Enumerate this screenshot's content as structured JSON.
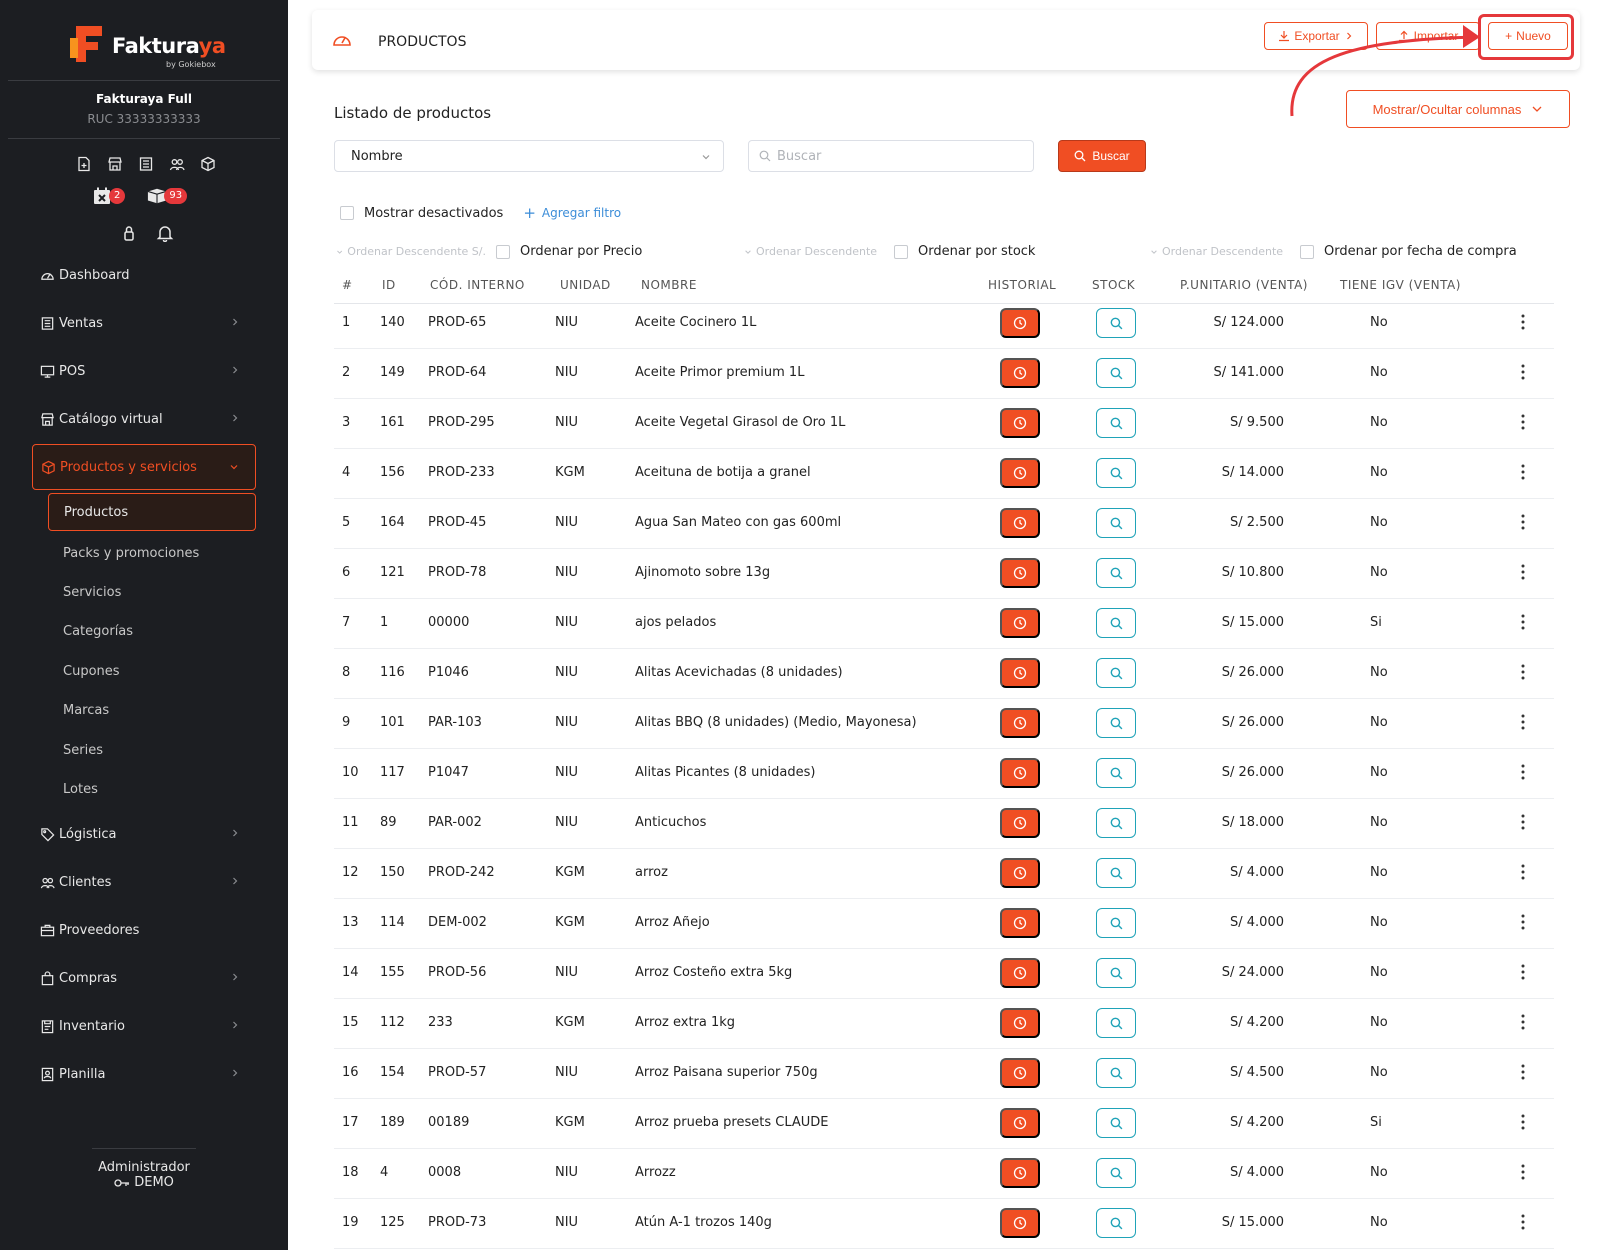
{
  "brand": {
    "name_a": "Faktura",
    "name_b": "ya",
    "sub": "by Gokiebox"
  },
  "company": {
    "name": "Fakturaya Full",
    "ruc": "RUC 33333333333"
  },
  "badges": {
    "calendar_count": "2",
    "box_count": "93"
  },
  "menu": {
    "dashboard": "Dashboard",
    "ventas": "Ventas",
    "pos": "POS",
    "catalogo": "Catálogo virtual",
    "productos_servicios": "Productos y servicios",
    "logistica": "Lógistica",
    "clientes": "Clientes",
    "proveedores": "Proveedores",
    "compras": "Compras",
    "inventario": "Inventario",
    "planilla": "Planilla"
  },
  "submenu": {
    "productos": "Productos",
    "packs": "Packs y promociones",
    "servicios": "Servicios",
    "categorias": "Categorías",
    "cupones": "Cupones",
    "marcas": "Marcas",
    "series": "Series",
    "lotes": "Lotes"
  },
  "footer": {
    "admin": "Administrador",
    "demo": "DEMO"
  },
  "header": {
    "title": "PRODUCTOS",
    "export": "Exportar",
    "import": "Importar",
    "new": "Nuevo"
  },
  "list": {
    "title": "Listado de productos",
    "columns_btn": "Mostrar/Ocultar columnas",
    "select_value": "Nombre",
    "search_placeholder": "Buscar",
    "search_btn": "Buscar",
    "show_disabled": "Mostrar desactivados",
    "add_filter": "Agregar filtro",
    "sort_placeholder_1": "Ordenar Descendente S/.",
    "sort_label_1": "Ordenar por Precio",
    "sort_placeholder_2": "Ordenar Descendente",
    "sort_label_2": "Ordenar por stock",
    "sort_placeholder_3": "Ordenar Descendente",
    "sort_label_3": "Ordenar por fecha de compra"
  },
  "table": {
    "headers": [
      "#",
      "ID",
      "CÓD. INTERNO",
      "UNIDAD",
      "NOMBRE",
      "HISTORIAL",
      "STOCK",
      "P.UNITARIO (VENTA)",
      "TIENE IGV (VENTA)"
    ],
    "rows": [
      [
        "1",
        "140",
        "PROD-65",
        "NIU",
        "Aceite Cocinero 1L",
        "S/ 124.000",
        "No"
      ],
      [
        "2",
        "149",
        "PROD-64",
        "NIU",
        "Aceite Primor premium 1L",
        "S/ 141.000",
        "No"
      ],
      [
        "3",
        "161",
        "PROD-295",
        "NIU",
        "Aceite Vegetal Girasol de Oro 1L",
        "S/ 9.500",
        "No"
      ],
      [
        "4",
        "156",
        "PROD-233",
        "KGM",
        "Aceituna de botija a granel",
        "S/ 14.000",
        "No"
      ],
      [
        "5",
        "164",
        "PROD-45",
        "NIU",
        "Agua San Mateo con gas 600ml",
        "S/ 2.500",
        "No"
      ],
      [
        "6",
        "121",
        "PROD-78",
        "NIU",
        "Ajinomoto sobre 13g",
        "S/ 10.800",
        "No"
      ],
      [
        "7",
        "1",
        "00000",
        "NIU",
        "ajos pelados",
        "S/ 15.000",
        "Si"
      ],
      [
        "8",
        "116",
        "P1046",
        "NIU",
        "Alitas Acevichadas (8 unidades)",
        "S/ 26.000",
        "No"
      ],
      [
        "9",
        "101",
        "PAR-103",
        "NIU",
        "Alitas BBQ (8 unidades) (Medio, Mayonesa)",
        "S/ 26.000",
        "No"
      ],
      [
        "10",
        "117",
        "P1047",
        "NIU",
        "Alitas Picantes (8 unidades)",
        "S/ 26.000",
        "No"
      ],
      [
        "11",
        "89",
        "PAR-002",
        "NIU",
        "Anticuchos",
        "S/ 18.000",
        "No"
      ],
      [
        "12",
        "150",
        "PROD-242",
        "KGM",
        "arroz",
        "S/ 4.000",
        "No"
      ],
      [
        "13",
        "114",
        "DEM-002",
        "KGM",
        "Arroz Añejo",
        "S/ 4.000",
        "No"
      ],
      [
        "14",
        "155",
        "PROD-56",
        "NIU",
        "Arroz Costeño extra 5kg",
        "S/ 24.000",
        "No"
      ],
      [
        "15",
        "112",
        "233",
        "KGM",
        "Arroz extra 1kg",
        "S/ 4.200",
        "No"
      ],
      [
        "16",
        "154",
        "PROD-57",
        "NIU",
        "Arroz Paisana superior 750g",
        "S/ 4.500",
        "No"
      ],
      [
        "17",
        "189",
        "00189",
        "KGM",
        "Arroz prueba presets CLAUDE",
        "S/ 4.200",
        "Si"
      ],
      [
        "18",
        "4",
        "0008",
        "NIU",
        "Arrozz",
        "S/ 4.000",
        "No"
      ],
      [
        "19",
        "125",
        "PROD-73",
        "NIU",
        "Atún A-1 trozos 140g",
        "S/ 15.000",
        "No"
      ]
    ]
  },
  "colors": {
    "accent": "#f04e23",
    "sidebar": "#1c1e22",
    "stock": "#1fa3b8",
    "highlight": "#e5383b"
  }
}
